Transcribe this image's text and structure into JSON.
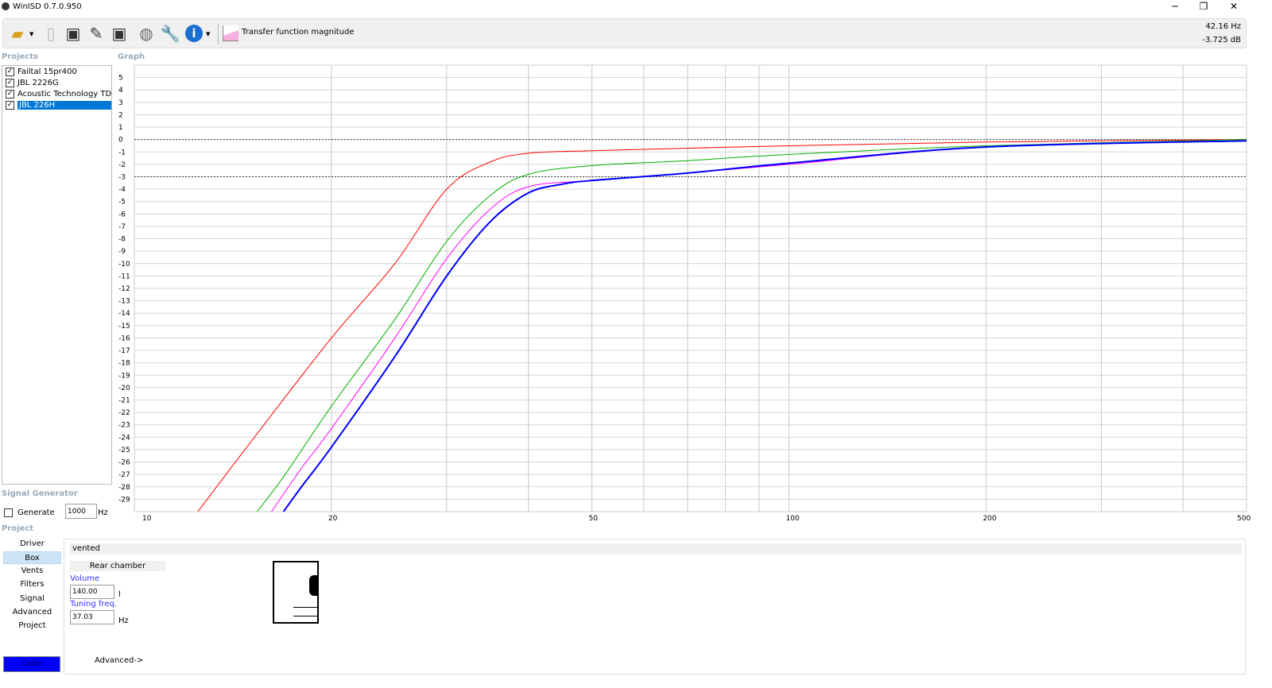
{
  "window": {
    "title": "WinISD 0.7.0.950",
    "minimize": "─",
    "restore": "❐",
    "close": "✕"
  },
  "toolbar": {
    "icons": [
      "open-folder-icon",
      "new-project-icon",
      "save-icon",
      "save-as-icon",
      "save-all-icon",
      "driver-icon",
      "wrench-icon",
      "info-icon"
    ],
    "graph_selector": "Transfer function magnitude",
    "cursor_freq": "42.16 Hz",
    "cursor_db": "-3.725 dB"
  },
  "projects": {
    "label": "Projects",
    "items": [
      {
        "name": "Failtal 15pr400",
        "checked": true,
        "color": "#ff0000"
      },
      {
        "name": "JBL 2226G",
        "checked": true,
        "color": "#00b000"
      },
      {
        "name": "Acoustic Technology TD15H",
        "checked": true,
        "color": "#ff00ff"
      },
      {
        "name": "JBL 226H",
        "checked": true,
        "selected": true,
        "color": "#0000ff"
      }
    ]
  },
  "graph": {
    "label": "Graph"
  },
  "signal_generator": {
    "label": "Signal Generator",
    "generate_label": "Generate",
    "generate_checked": false,
    "frequency": "1000",
    "unit": "Hz"
  },
  "project": {
    "label": "Project",
    "nav": [
      "Driver",
      "Box",
      "Vents",
      "Filters",
      "Signal",
      "Advanced",
      "Project"
    ],
    "active_nav": "Box",
    "color_button": "Color",
    "box_type": "vented",
    "chamber_header": "Rear chamber",
    "volume_label": "Volume",
    "volume": "140.00",
    "volume_unit": "l",
    "tuning_label": "Tuning freq.",
    "tuning": "37.03",
    "tuning_unit": "Hz",
    "advanced_link": "Advanced->"
  },
  "chart_data": {
    "type": "line",
    "title": "",
    "xlabel": "",
    "ylabel": "",
    "xscale": "log",
    "xlim": [
      10,
      500
    ],
    "ylim": [
      -30,
      6
    ],
    "grid": true,
    "xticks": [
      10,
      20,
      50,
      100,
      200,
      500
    ],
    "xgrid": [
      20,
      30,
      40,
      50,
      60,
      70,
      80,
      90,
      100,
      200,
      300,
      400
    ],
    "yticks": [
      5,
      4,
      3,
      2,
      1,
      0,
      -1,
      -2,
      -3,
      -4,
      -5,
      -6,
      -7,
      -8,
      -9,
      -10,
      -11,
      -12,
      -13,
      -14,
      -15,
      -16,
      -17,
      -18,
      -19,
      -20,
      -21,
      -22,
      -23,
      -24,
      -25,
      -26,
      -27,
      -28,
      -29
    ],
    "reference_lines": [
      0,
      -3
    ],
    "series": [
      {
        "name": "Failtal 15pr400",
        "color": "#ff0000",
        "x": [
          12.5,
          15,
          20,
          25,
          30,
          35,
          40,
          50,
          70,
          100,
          200,
          500
        ],
        "y": [
          -30,
          -24.5,
          -16,
          -10,
          -4,
          -1.8,
          -1.1,
          -0.9,
          -0.7,
          -0.5,
          -0.2,
          0
        ]
      },
      {
        "name": "JBL 2226G",
        "color": "#00b000",
        "x": [
          15.4,
          17,
          20,
          25,
          30,
          35,
          40,
          50,
          70,
          100,
          200,
          500
        ],
        "y": [
          -30,
          -27,
          -21.5,
          -14.5,
          -8.2,
          -4.5,
          -2.8,
          -2.1,
          -1.7,
          -1.2,
          -0.5,
          0
        ]
      },
      {
        "name": "Acoustic Technology TD15H",
        "color": "#ff00ff",
        "x": [
          16.2,
          18,
          20,
          25,
          30,
          35,
          40,
          50,
          70,
          100,
          200,
          500
        ],
        "y": [
          -30,
          -26.5,
          -23.3,
          -16,
          -9.6,
          -5.6,
          -3.8,
          -3.3,
          -2.7,
          -2,
          -0.6,
          -0.1
        ]
      },
      {
        "name": "JBL 226H",
        "color": "#0000ff",
        "x": [
          16.9,
          18,
          20,
          25,
          30,
          35,
          40,
          45,
          50,
          70,
          100,
          200,
          500
        ],
        "y": [
          -30,
          -28,
          -24.8,
          -17.5,
          -11,
          -6.6,
          -4.3,
          -3.6,
          -3.3,
          -2.7,
          -1.9,
          -0.6,
          -0.1
        ]
      }
    ]
  }
}
